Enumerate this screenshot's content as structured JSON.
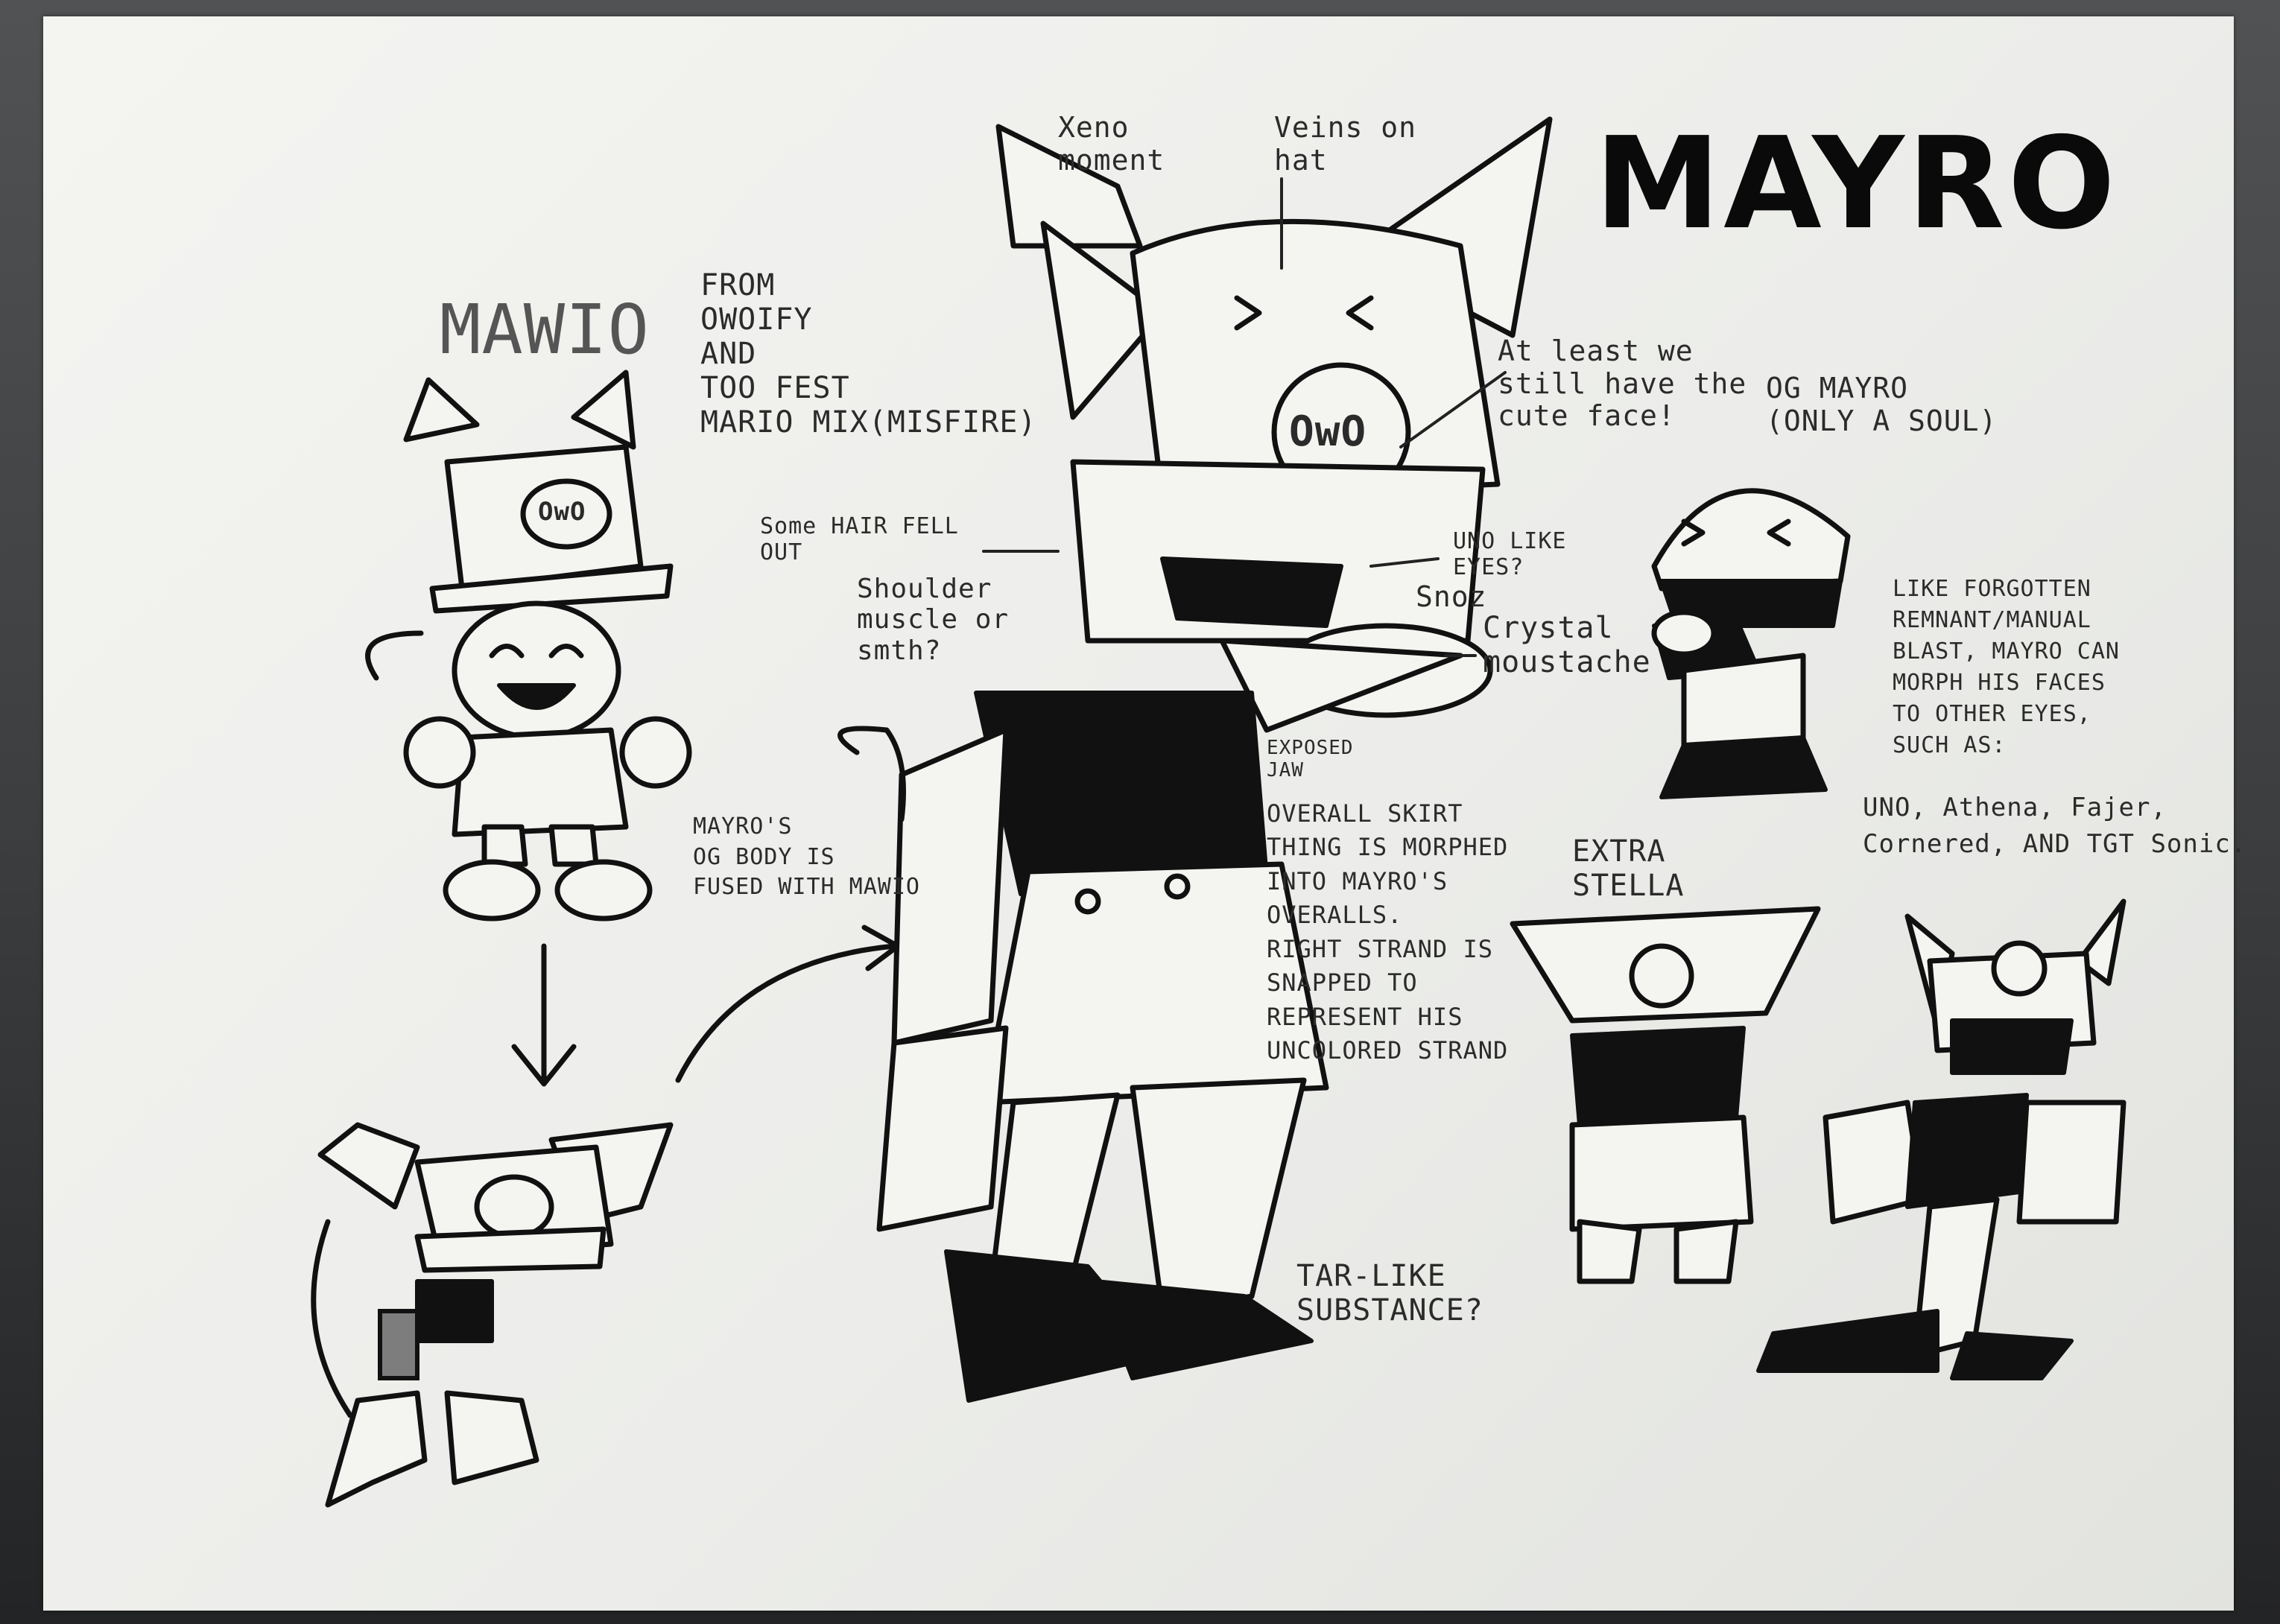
{
  "sheet": {
    "title": "MAYRO",
    "mawio_heading": "MAWIO",
    "mawio_source": "FROM\nOWOIFY\nAND\nTOO FEST\nMARIO MIX(MISFIRE)",
    "hat_face": "OwO",
    "notes": {
      "xeno": "Xeno\nmoment",
      "veins": "Veins on\nhat",
      "cute_face": "At least we\nstill have the\ncute face!",
      "hair": "Some HAIR FELL\nOUT",
      "shoulder": "Shoulder\nmuscle or\nsmth?",
      "uno_eyes": "UNO LIKE\nEYES?",
      "snoz": "Snoz",
      "crystal": "Crystal\nmoustache",
      "jaw": "EXPOSED\nJAW",
      "overall": "OVERALL SKIRT\nTHING IS MORPHED\nINTO MAYRO'S\nOVERALLS.\nRIGHT STRAND IS\nSNAPPED TO\nREPRESENT HIS\nUNCOLORED STRAND",
      "og_body": "MAYRO'S\nOG BODY IS\nFUSED WITH MAWIO",
      "tar": "TAR-LIKE\nSUBSTANCE?",
      "og_mayro": "OG MAYRO\n(ONLY A SOUL)",
      "extra": "EXTRA\nSTELLA",
      "forgotten": "LIKE FORGOTTEN\nREMNANT/MANUAL\nBLAST, MAYRO CAN\nMORPH HIS FACES\nTO OTHER EYES,\nSUCH AS:",
      "examples": "UNO, Athena, Fajer,\nCornered, AND TGT Sonic."
    }
  }
}
